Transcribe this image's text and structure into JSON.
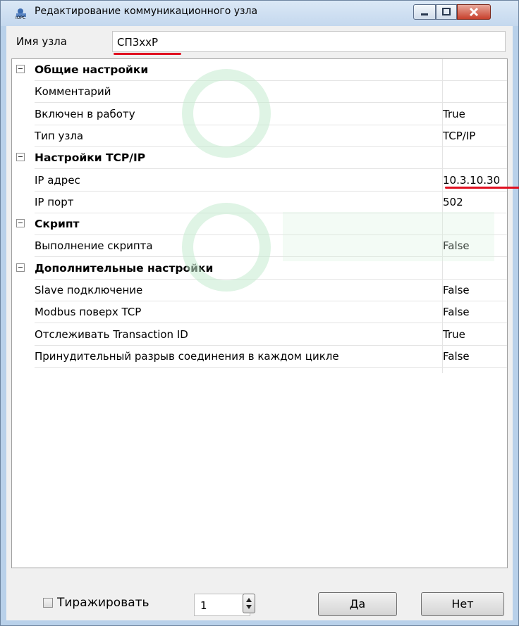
{
  "window": {
    "title": "Редактирование коммуникационного узла"
  },
  "node": {
    "label": "Имя узла",
    "value": "СП3ххР"
  },
  "properties": [
    {
      "type": "category",
      "label": "Общие настройки",
      "value": ""
    },
    {
      "type": "item",
      "label": "Комментарий",
      "value": ""
    },
    {
      "type": "item",
      "label": "Включен в работу",
      "value": "True"
    },
    {
      "type": "item",
      "label": "Тип узла",
      "value": "TCP/IP"
    },
    {
      "type": "category",
      "label": "Настройки TCP/IP",
      "value": ""
    },
    {
      "type": "item",
      "label": "IP адрес",
      "value": "10.3.10.30"
    },
    {
      "type": "item",
      "label": "IP порт",
      "value": "502"
    },
    {
      "type": "category",
      "label": "Скрипт",
      "value": ""
    },
    {
      "type": "item",
      "label": "Выполнение скрипта",
      "value": "False"
    },
    {
      "type": "category",
      "label": "Дополнительные настройки",
      "value": ""
    },
    {
      "type": "item",
      "label": "Slave подключение",
      "value": "False"
    },
    {
      "type": "item",
      "label": "Modbus поверх TCP",
      "value": "False"
    },
    {
      "type": "item",
      "label": "Отслеживать Transaction ID",
      "value": "True"
    },
    {
      "type": "item",
      "label": "Принудительный разрыв соединения в каждом цикле",
      "value": "False"
    }
  ],
  "footer": {
    "replicate_label": "Тиражировать",
    "count_value": "1",
    "ok_label": "Да",
    "cancel_label": "Нет"
  },
  "colors": {
    "highlight_underline": "#e01020"
  }
}
